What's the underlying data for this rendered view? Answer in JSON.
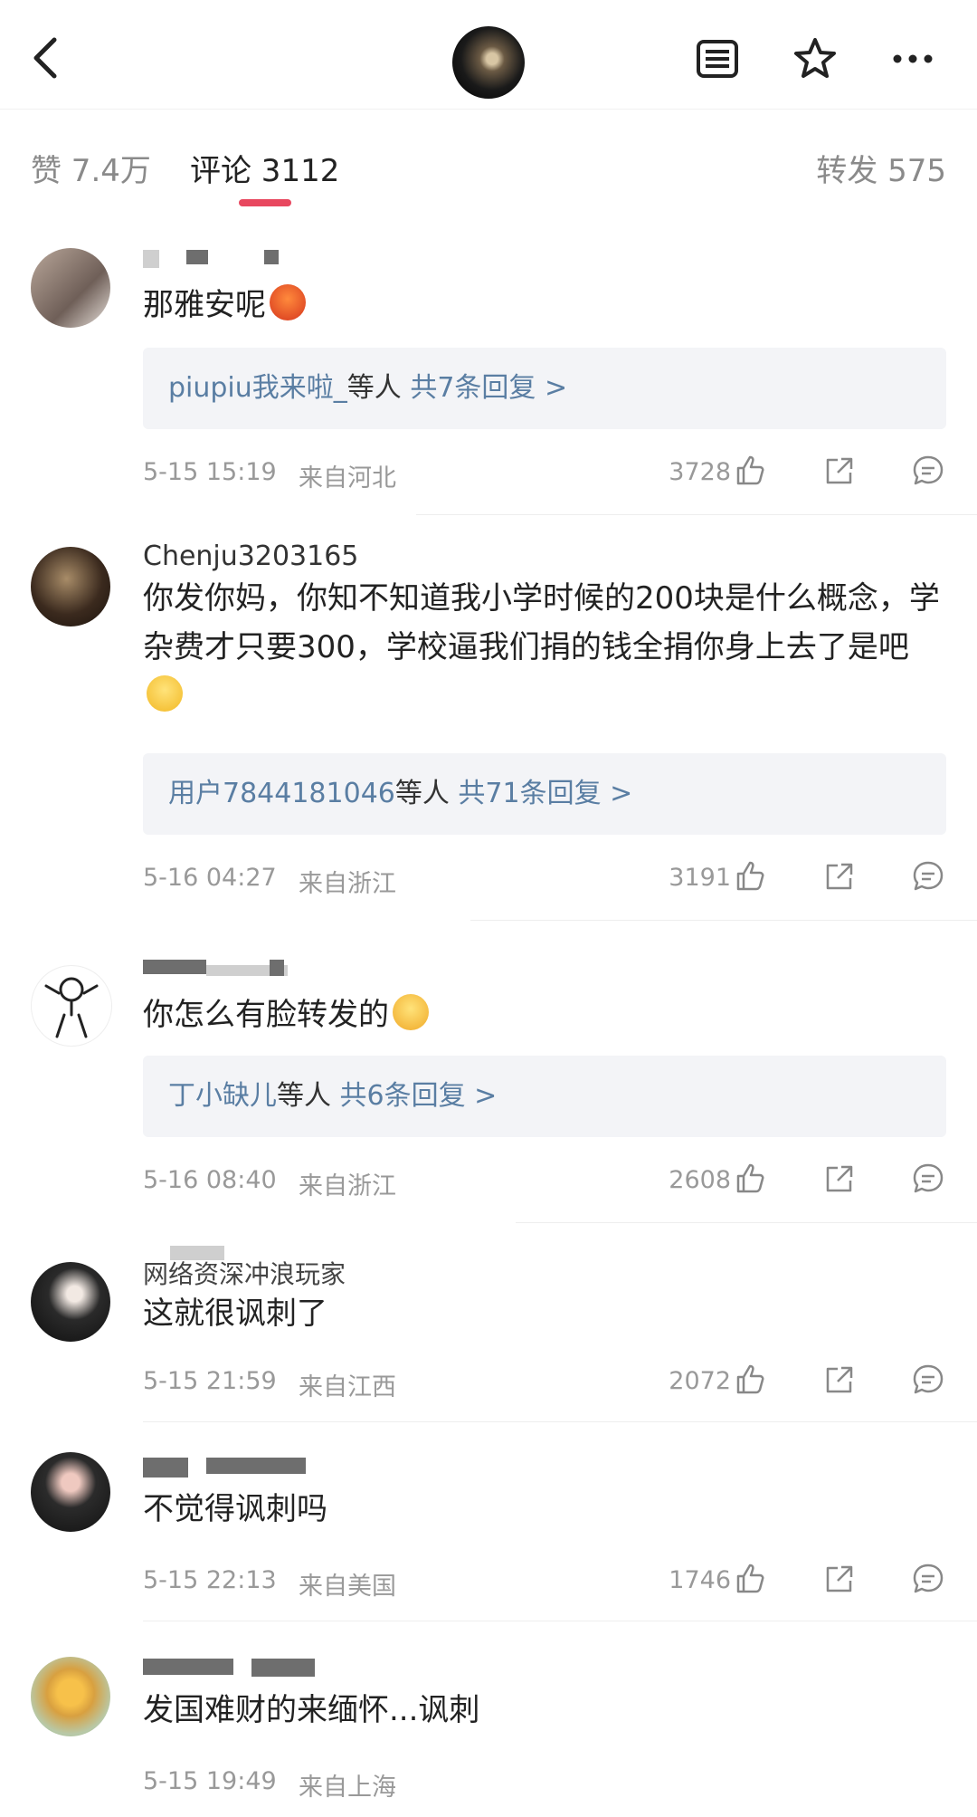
{
  "header": {
    "back_icon": "chevron-left-icon",
    "icons": [
      "article-icon",
      "star-icon",
      "more-icon"
    ]
  },
  "tabs": {
    "likes": "赞 7.4万",
    "comments": "评论 3112",
    "reposts": "转发 575"
  },
  "comments": [
    {
      "username": "",
      "text": "那雅安呢",
      "emoji": "angry-emoji",
      "replies_prefix": "piupiu我来啦_",
      "replies_mid": "等人",
      "replies_count": "共7条回复 >",
      "date": "5-15 15:19",
      "location": "来自河北",
      "likes": "3728"
    },
    {
      "username": "Chenju3203165",
      "text": "你发你妈，你知不知道我小学时候的200块是什么概念，学杂费才只要300，学校逼我们捐的钱全捐你身上去了是吧",
      "emoji": "smile-emoji",
      "replies_prefix": "用户7844181046",
      "replies_mid": "等人",
      "replies_count": "共71条回复 >",
      "date": "5-16 04:27",
      "location": "来自浙江",
      "likes": "3191"
    },
    {
      "username": "",
      "text": "你怎么有脸转发的",
      "emoji": "blush-emoji",
      "replies_prefix": "丁小缺儿",
      "replies_mid": "等人",
      "replies_count": "共6条回复 >",
      "date": "5-16 08:40",
      "location": "来自浙江",
      "likes": "2608"
    },
    {
      "username": "网络资深冲浪玩家",
      "text": "这就很讽刺了",
      "date": "5-15 21:59",
      "location": "来自江西",
      "likes": "2072"
    },
    {
      "username": "",
      "text": "不觉得讽刺吗",
      "date": "5-15 22:13",
      "location": "来自美国",
      "likes": "1746"
    },
    {
      "username": "",
      "text": "发国难财的来缅怀...讽刺",
      "date": "5-15 19:49",
      "location": "来自上海",
      "likes": ""
    }
  ],
  "action_icons": [
    "thumbs-up-icon",
    "share-icon",
    "comment-icon"
  ],
  "colors": {
    "accent": "#e8475f",
    "link": "#5a7ea3",
    "meta": "#999999",
    "reply_bg": "#f3f4f7"
  }
}
